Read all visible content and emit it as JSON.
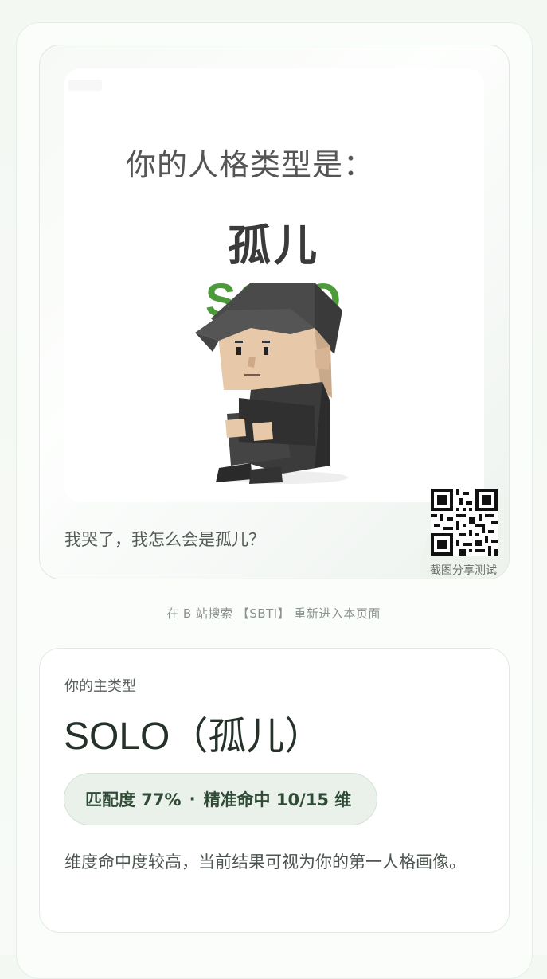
{
  "share_card": {
    "poster": {
      "heading": "你的人格类型是：",
      "name_cn": "孤儿",
      "name_en": "SOLO"
    },
    "caption": "我哭了，我怎么会是孤儿？",
    "qr_label": "截图分享测试"
  },
  "search_hint": "在 B 站搜索 【SBTI】 重新进入本页面",
  "result": {
    "label": "你的主类型",
    "title": "SOLO（孤儿）",
    "match_rate": "匹配度 77%",
    "separator": "·",
    "precision": "精准命中 10/15 维",
    "description": "维度命中度较高，当前结果可视为你的第一人格画像。"
  },
  "colors": {
    "accent_green": "#4c9a3a",
    "pill_bg": "#e9f1ea"
  }
}
